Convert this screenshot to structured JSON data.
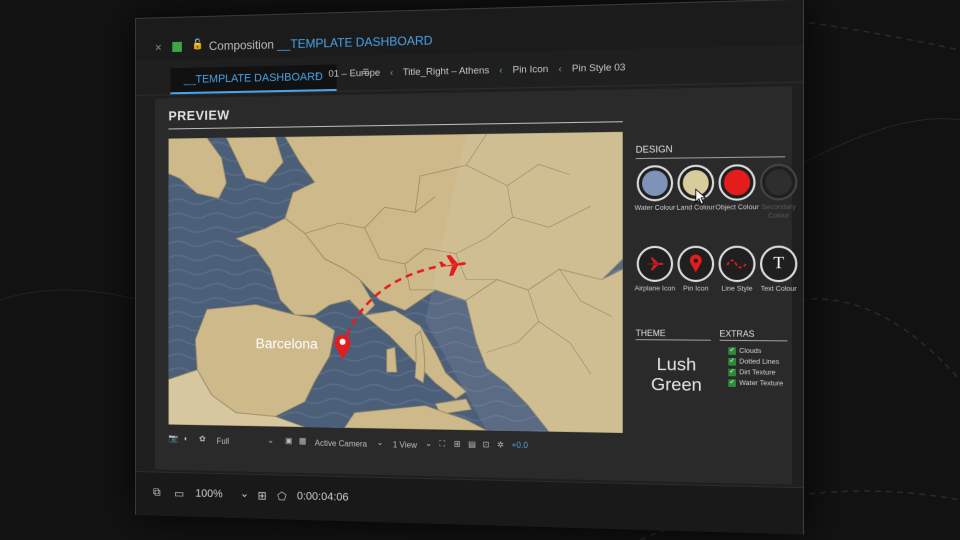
{
  "window": {
    "close_glyph": "×",
    "lock_glyph": "🔓",
    "title_prefix": "Composition",
    "title_comp": "__TEMPLATE DASHBOARD"
  },
  "tabs": {
    "active": "__TEMPLATE DASHBOARD",
    "menu_glyph": "≡"
  },
  "breadcrumbs": [
    "01 – Europe",
    "Title_Right – Athens",
    "Pin Icon",
    "Pin Style 03"
  ],
  "breadcrumb_separator": "‹",
  "preview": {
    "title": "PREVIEW",
    "city_label": "Barcelona"
  },
  "design": {
    "title": "DESIGN",
    "buttons": [
      {
        "label": "Water Colour",
        "swatch": "#7f93b8",
        "icon": "swatch-icon"
      },
      {
        "label": "Land Colour",
        "swatch": "#d8cc9c",
        "icon": "swatch-icon"
      },
      {
        "label": "Object Colour",
        "swatch": "#e51c1c",
        "icon": "swatch-icon"
      },
      {
        "label": "Secondary Colour",
        "swatch": "#3a3a3a",
        "icon": "swatch-icon",
        "disabled": true
      },
      {
        "label": "Airplane Icon",
        "icon": "airplane-icon"
      },
      {
        "label": "Pin Icon",
        "icon": "pin-icon"
      },
      {
        "label": "Line Style",
        "icon": "line-style-icon"
      },
      {
        "label": "Text Colour",
        "icon": "text-icon",
        "glyph": "T"
      }
    ]
  },
  "theme": {
    "title": "THEME",
    "line1": "Lush",
    "line2": "Green"
  },
  "extras": {
    "title": "EXTRAS",
    "items": [
      {
        "label": "Clouds",
        "checked": true
      },
      {
        "label": "Dotted Lines",
        "checked": true
      },
      {
        "label": "Dirt Texture",
        "checked": true
      },
      {
        "label": "Water Texture",
        "checked": true
      }
    ],
    "check_glyph": "✓"
  },
  "viewer_footer": {
    "resolution": "Full",
    "camera": "Active Camera",
    "views": "1 View",
    "exposure": "+0.0",
    "dropdown_glyph": "⌄"
  },
  "toolbar": {
    "zoom": "100%",
    "timecode": "0:00:04:06",
    "dropdown_glyph": "⌄"
  },
  "colors": {
    "accent": "#4aa3e8",
    "pin_red": "#e51c1c",
    "water": "#4c5f79",
    "land": "#cdb98a",
    "check_green": "#2e8b3a"
  }
}
